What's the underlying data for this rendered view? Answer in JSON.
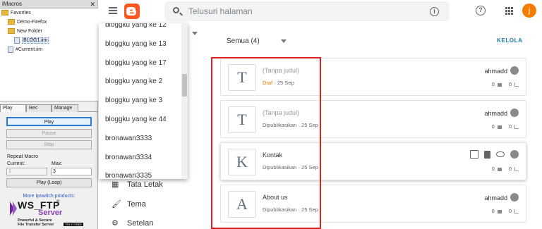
{
  "imacros": {
    "title": "iMacros",
    "close": "✕",
    "tree": [
      {
        "label": "Favorites",
        "type": "folder",
        "indent": 0
      },
      {
        "label": "Demo-Firefox",
        "type": "folder",
        "indent": 1
      },
      {
        "label": "New Folder",
        "type": "folder",
        "indent": 1
      },
      {
        "label": "BLOG1.iim",
        "type": "file",
        "indent": 2,
        "selected": true
      },
      {
        "label": "#Current.iim",
        "type": "file",
        "indent": 1
      }
    ],
    "tabs": [
      "Play",
      "Rec",
      "Manage"
    ],
    "buttons": {
      "play": "Play",
      "pause": "Pause",
      "stop": "Stop",
      "play_loop": "Play (Loop)"
    },
    "repeat_label": "Repeat Macro",
    "current_label": "Current:",
    "max_label": "Max:",
    "current_value": "1",
    "max_value": "3",
    "more_products": "More Ipswitch products:",
    "ad": {
      "brand": "WS_FTP",
      "reg": "®",
      "server": "Server",
      "tagline1": "Powerful & Secure",
      "tagline2": "File Transfer Server",
      "trial": "TRY IT FREE"
    }
  },
  "header": {
    "search_placeholder": "Telusuri halaman",
    "info": "i",
    "help": "?",
    "avatar": "j"
  },
  "blog_dropdown": [
    "bloggku yang ke 12",
    "bloggku yang ke 13",
    "bloggku yang ke 17",
    "bloggku yang ke 2",
    "bloggku yang ke 3",
    "bloggku yang ke 44",
    "bronawan3333",
    "bronawan3334",
    "bronawan3335"
  ],
  "nav": [
    {
      "label": "Tata Letak",
      "icon": "▦"
    },
    {
      "label": "Tema",
      "icon": "🖌"
    },
    {
      "label": "Setelan",
      "icon": "⚙"
    }
  ],
  "filter": {
    "label": "Semua (4)",
    "manage": "KELOLA"
  },
  "posts": [
    {
      "letter": "T",
      "title": "(Tanpa judul)",
      "status": "Draf",
      "date": "· 25 Sep",
      "author": "ahmadd",
      "comments": "0",
      "views": "0",
      "muted": true,
      "draft": true,
      "hover": false
    },
    {
      "letter": "T",
      "title": "(Tanpa judul)",
      "status": "Dipublikasikan",
      "date": "· 25 Sep",
      "author": "ahmadd",
      "comments": "0",
      "views": "0",
      "muted": true,
      "draft": false,
      "hover": false
    },
    {
      "letter": "K",
      "title": "Kontak",
      "status": "Dipublikasikan",
      "date": "· 25 Sep",
      "author": "",
      "comments": "0",
      "views": "0",
      "muted": false,
      "draft": false,
      "hover": true
    },
    {
      "letter": "A",
      "title": "About us",
      "status": "Dipublikasikan",
      "date": "· 25 Sep",
      "author": "ahmadd",
      "comments": "0",
      "views": "0",
      "muted": false,
      "draft": false,
      "hover": false
    }
  ]
}
